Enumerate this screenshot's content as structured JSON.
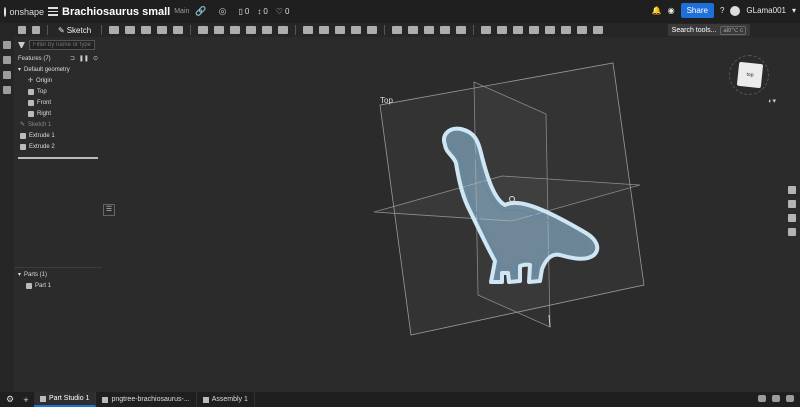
{
  "app": {
    "brand": "onshape",
    "doc_title": "Brachiosaurus small",
    "branch": "Main",
    "counts": {
      "a": "0",
      "b": "0",
      "c": "0"
    },
    "share_label": "Share",
    "user": "GLama001"
  },
  "toolbar": {
    "sketch_label": "Sketch",
    "search_tools": "Search tools...",
    "search_kbd": "alt/⌥ c"
  },
  "features": {
    "filter_placeholder": "Filter by name or type",
    "header": "Features (7)",
    "default_geometry": "Default geometry",
    "items": [
      "Origin",
      "Top",
      "Front",
      "Right",
      "Sketch 1",
      "Extrude 1",
      "Extrude 2"
    ]
  },
  "parts": {
    "header": "Parts (1)",
    "items": [
      "Part 1"
    ]
  },
  "viewport": {
    "plane_label": "Top",
    "cube_face": "top"
  },
  "tabs": {
    "items": [
      {
        "label": "Part Studio 1"
      },
      {
        "label": "pngtree-brachiosaurus-..."
      },
      {
        "label": "Assembly 1"
      }
    ]
  },
  "colors": {
    "accent": "#1e6fd9",
    "part": "#9fc9e6",
    "part_stroke": "#cfe6f5"
  }
}
